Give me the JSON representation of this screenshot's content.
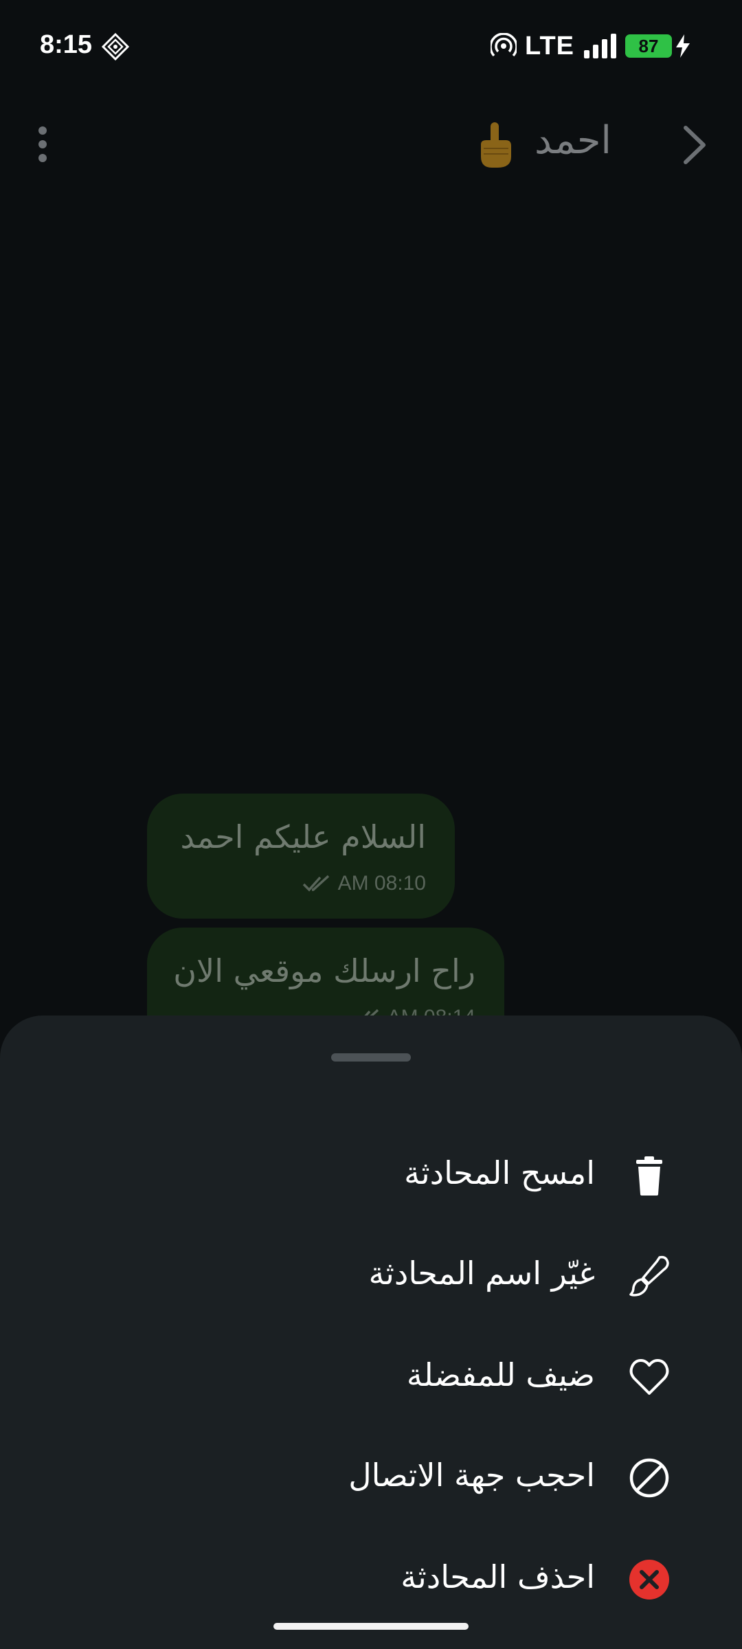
{
  "status_bar": {
    "time": "8:15",
    "network": "LTE",
    "battery": "87"
  },
  "header": {
    "contact_name": "احمد",
    "emoji": "☝️"
  },
  "messages": [
    {
      "text": "السلام عليكم احمد",
      "time": "AM 08:10"
    },
    {
      "text": "راح ارسلك موقعي الان",
      "time": "AM 08:14"
    }
  ],
  "menu": {
    "items": [
      {
        "label": "امسح المحادثة",
        "icon": "trash-icon"
      },
      {
        "label": "غيّر اسم المحادثة",
        "icon": "brush-icon"
      },
      {
        "label": "ضيف للمفضلة",
        "icon": "heart-icon"
      },
      {
        "label": "احجب جهة الاتصال",
        "icon": "block-icon"
      },
      {
        "label": "احذف المحادثة",
        "icon": "delete-x-icon"
      }
    ]
  },
  "colors": {
    "background": "#0b0e10",
    "sheet": "#1b2023",
    "bubble": "#132513",
    "battery": "#2fc146",
    "danger": "#e5322d"
  }
}
